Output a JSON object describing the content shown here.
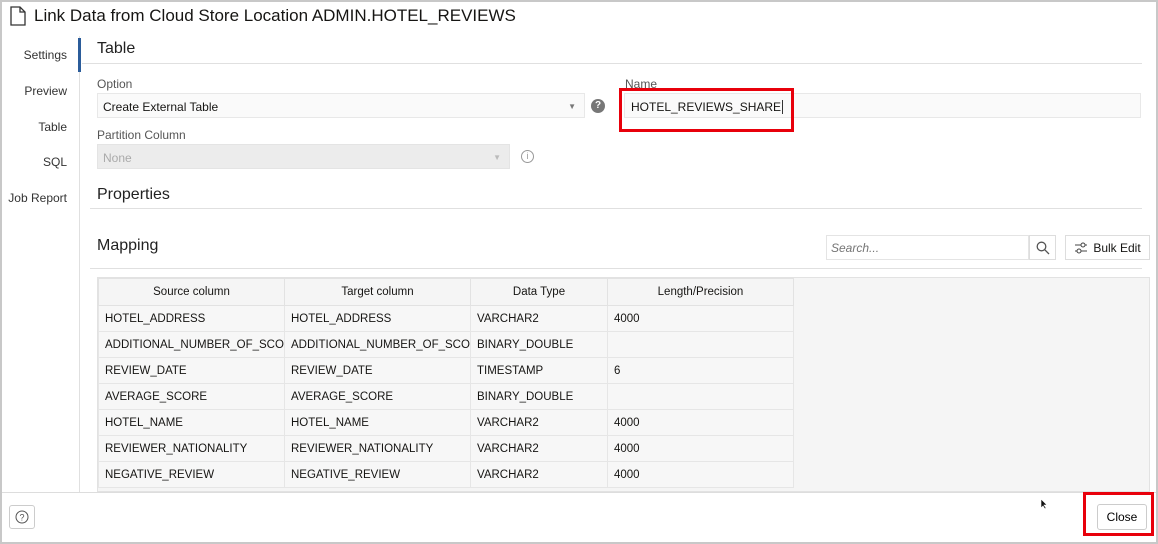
{
  "dialog": {
    "title": "Link Data from Cloud Store Location ADMIN.HOTEL_REVIEWS"
  },
  "sidebar": {
    "items": [
      {
        "label": "Settings",
        "active": true
      },
      {
        "label": "Preview"
      },
      {
        "label": "Table"
      },
      {
        "label": "SQL"
      },
      {
        "label": "Job Report"
      }
    ]
  },
  "table_section": {
    "heading": "Table",
    "option_label": "Option",
    "option_value": "Create External Table",
    "name_label": "Name",
    "name_value": "HOTEL_REVIEWS_SHARE",
    "partition_label": "Partition Column",
    "partition_value": "None"
  },
  "properties": {
    "heading": "Properties"
  },
  "mapping": {
    "heading": "Mapping",
    "search_placeholder": "Search...",
    "bulk_edit_label": "Bulk Edit",
    "columns": [
      "Source column",
      "Target column",
      "Data Type",
      "Length/Precision"
    ],
    "rows": [
      [
        "HOTEL_ADDRESS",
        "HOTEL_ADDRESS",
        "VARCHAR2",
        "4000"
      ],
      [
        "ADDITIONAL_NUMBER_OF_SCORING",
        "ADDITIONAL_NUMBER_OF_SCORING",
        "BINARY_DOUBLE",
        ""
      ],
      [
        "REVIEW_DATE",
        "REVIEW_DATE",
        "TIMESTAMP",
        "6"
      ],
      [
        "AVERAGE_SCORE",
        "AVERAGE_SCORE",
        "BINARY_DOUBLE",
        ""
      ],
      [
        "HOTEL_NAME",
        "HOTEL_NAME",
        "VARCHAR2",
        "4000"
      ],
      [
        "REVIEWER_NATIONALITY",
        "REVIEWER_NATIONALITY",
        "VARCHAR2",
        "4000"
      ],
      [
        "NEGATIVE_REVIEW",
        "NEGATIVE_REVIEW",
        "VARCHAR2",
        "4000"
      ]
    ]
  },
  "footer": {
    "close_label": "Close"
  },
  "colors": {
    "highlight": "#e8000b",
    "accent": "#2b5c9a"
  }
}
